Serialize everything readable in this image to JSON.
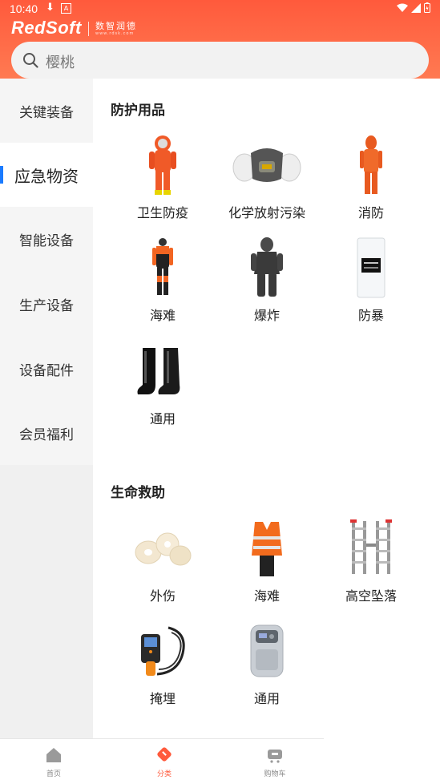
{
  "status": {
    "time": "10:40",
    "app_icon_letter": "A"
  },
  "brand": {
    "name": "RedSoft",
    "cn": "数智润德",
    "url": "www.rdsk.com"
  },
  "search": {
    "placeholder": "樱桃"
  },
  "sidebar": {
    "items": [
      {
        "label": "关键装备",
        "active": false
      },
      {
        "label": "应急物资",
        "active": true
      },
      {
        "label": "智能设备",
        "active": false
      },
      {
        "label": "生产设备",
        "active": false
      },
      {
        "label": "设备配件",
        "active": false
      },
      {
        "label": "会员福利",
        "active": false
      }
    ]
  },
  "sections": [
    {
      "title": "防护用品",
      "products": [
        {
          "label": "卫生防疫",
          "icon": "orange-hazmat-suit"
        },
        {
          "label": "化学放射污染",
          "icon": "gas-mask"
        },
        {
          "label": "消防",
          "icon": "fire-suit"
        },
        {
          "label": "海难",
          "icon": "wetsuit"
        },
        {
          "label": "爆炸",
          "icon": "bomb-suit"
        },
        {
          "label": "防暴",
          "icon": "riot-shield"
        },
        {
          "label": "通用",
          "icon": "rubber-boots"
        }
      ]
    },
    {
      "title": "生命救助",
      "products": [
        {
          "label": "外伤",
          "icon": "bandage-rolls"
        },
        {
          "label": "海难",
          "icon": "life-vest"
        },
        {
          "label": "高空坠落",
          "icon": "ladder"
        },
        {
          "label": "掩埋",
          "icon": "inspection-camera"
        },
        {
          "label": "通用",
          "icon": "oxygen-concentrator"
        }
      ]
    }
  ],
  "tabbar": [
    {
      "label": "首页",
      "active": false
    },
    {
      "label": "分类",
      "active": true
    },
    {
      "label": "购物车",
      "active": false
    }
  ],
  "colors": {
    "accent": "#ff5a3c",
    "active_indicator": "#1a7bff"
  }
}
